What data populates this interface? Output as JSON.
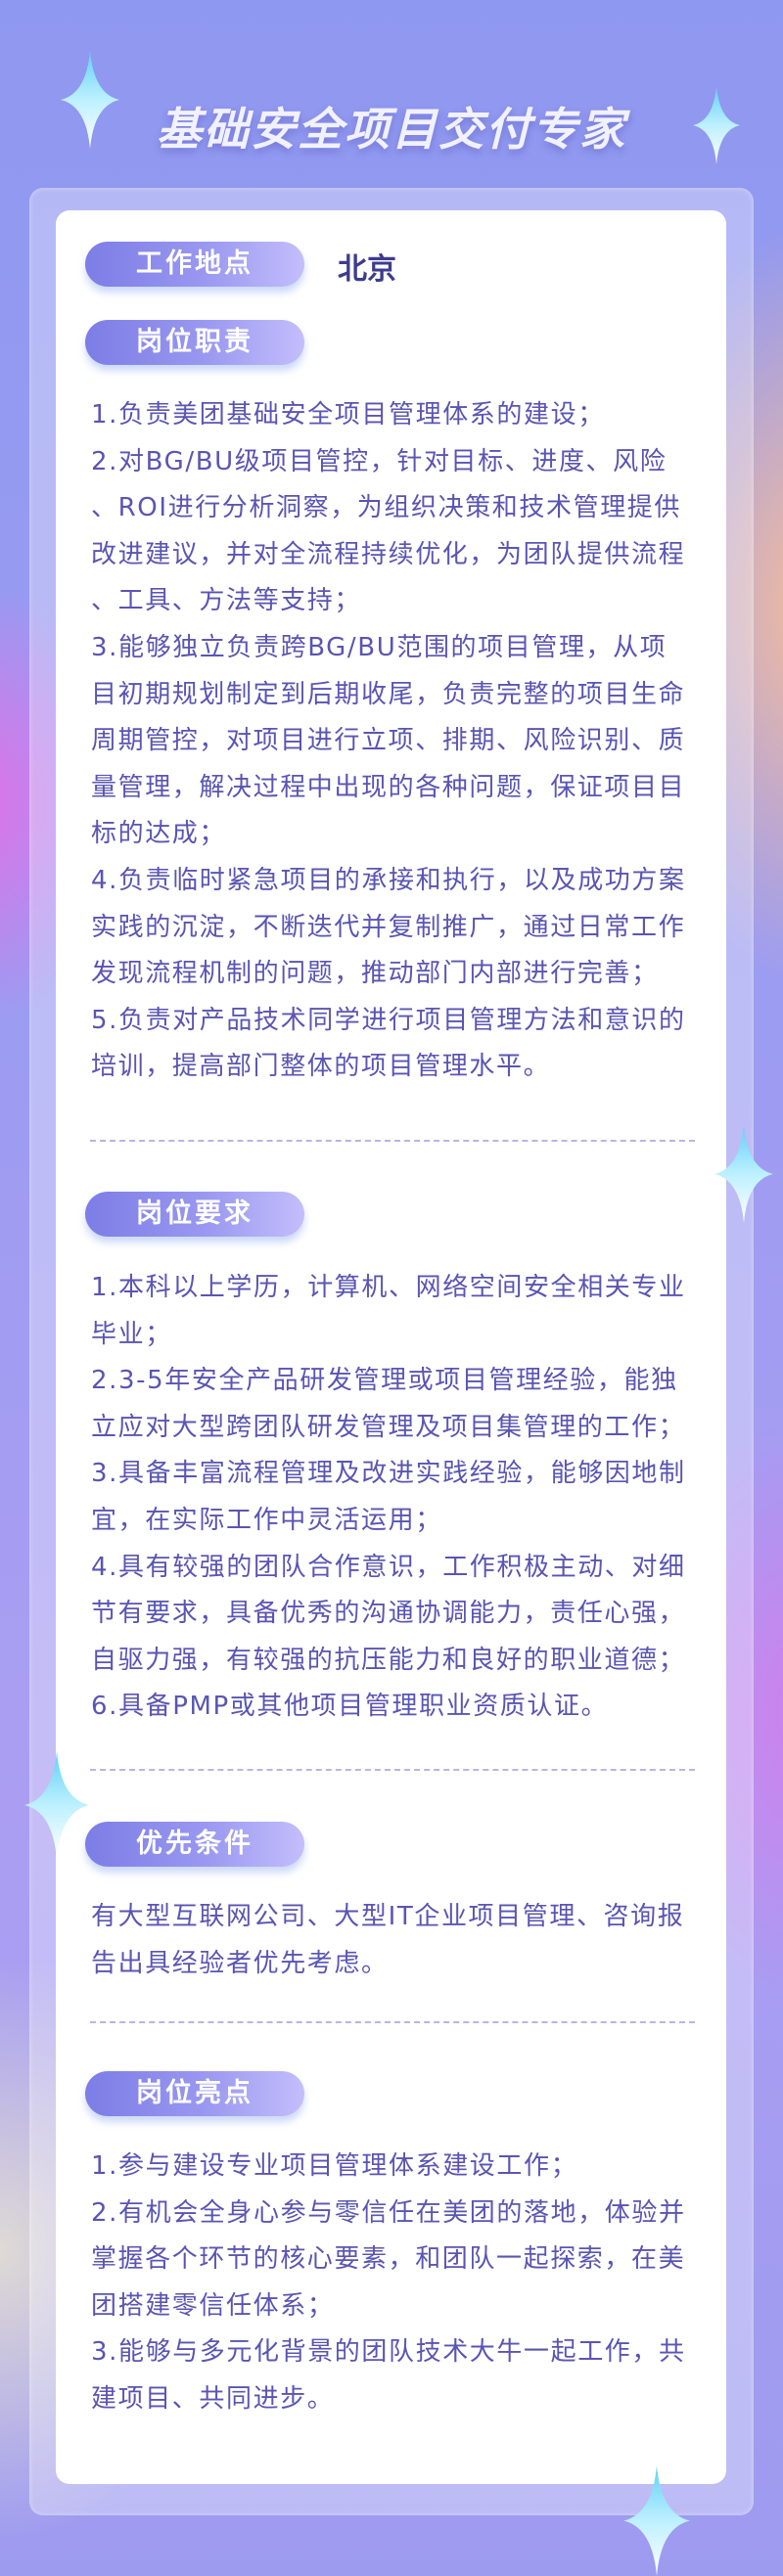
{
  "title": "基础安全项目交付专家",
  "location": {
    "label": "工作地点",
    "value": "北京"
  },
  "sections": [
    {
      "label": "岗位职责",
      "lines": [
        "1.负责美团基础安全项目管理体系的建设；",
        "2.对BG/BU级项目管控，针对目标、进度、风险",
        "、ROI进行分析洞察，为组织决策和技术管理提供",
        "改进建议，并对全流程持续优化，为团队提供流程",
        "、工具、方法等支持；",
        "3.能够独立负责跨BG/BU范围的项目管理，从项",
        "目初期规划制定到后期收尾，负责完整的项目生命",
        "周期管控，对项目进行立项、排期、风险识别、质",
        "量管理，解决过程中出现的各种问题，保证项目目",
        "标的达成；",
        "4.负责临时紧急项目的承接和执行，以及成功方案",
        "实践的沉淀，不断迭代并复制推广，通过日常工作",
        "发现流程机制的问题，推动部门内部进行完善；",
        "5.负责对产品技术同学进行项目管理方法和意识的",
        "培训，提高部门整体的项目管理水平。"
      ]
    },
    {
      "label": "岗位要求",
      "lines": [
        "1.本科以上学历，计算机、网络空间安全相关专业",
        "毕业；",
        "2.3-5年安全产品研发管理或项目管理经验，能独",
        "立应对大型跨团队研发管理及项目集管理的工作；",
        "3.具备丰富流程管理及改进实践经验，能够因地制",
        "宜，在实际工作中灵活运用；",
        "4.具有较强的团队合作意识，工作积极主动、对细",
        "节有要求，具备优秀的沟通协调能力，责任心强，",
        "自驱力强，有较强的抗压能力和良好的职业道德；",
        "6.具备PMP或其他项目管理职业资质认证。"
      ]
    },
    {
      "label": "优先条件",
      "lines": [
        "有大型互联网公司、大型IT企业项目管理、咨询报",
        "告出具经验者优先考虑。"
      ]
    },
    {
      "label": "岗位亮点",
      "lines": [
        "1.参与建设专业项目管理体系建设工作；",
        "2.有机会全身心参与零信任在美团的落地，体验并",
        "掌握各个环节的核心要素，和团队一起探索，在美",
        "团搭建零信任体系；",
        "3.能够与多元化背景的团队技术大牛一起工作，共",
        "建项目、共同进步。"
      ]
    }
  ],
  "colors": {
    "accent": "#7c7de6",
    "text": "#5a55b2",
    "location": "#3e3b8e"
  }
}
